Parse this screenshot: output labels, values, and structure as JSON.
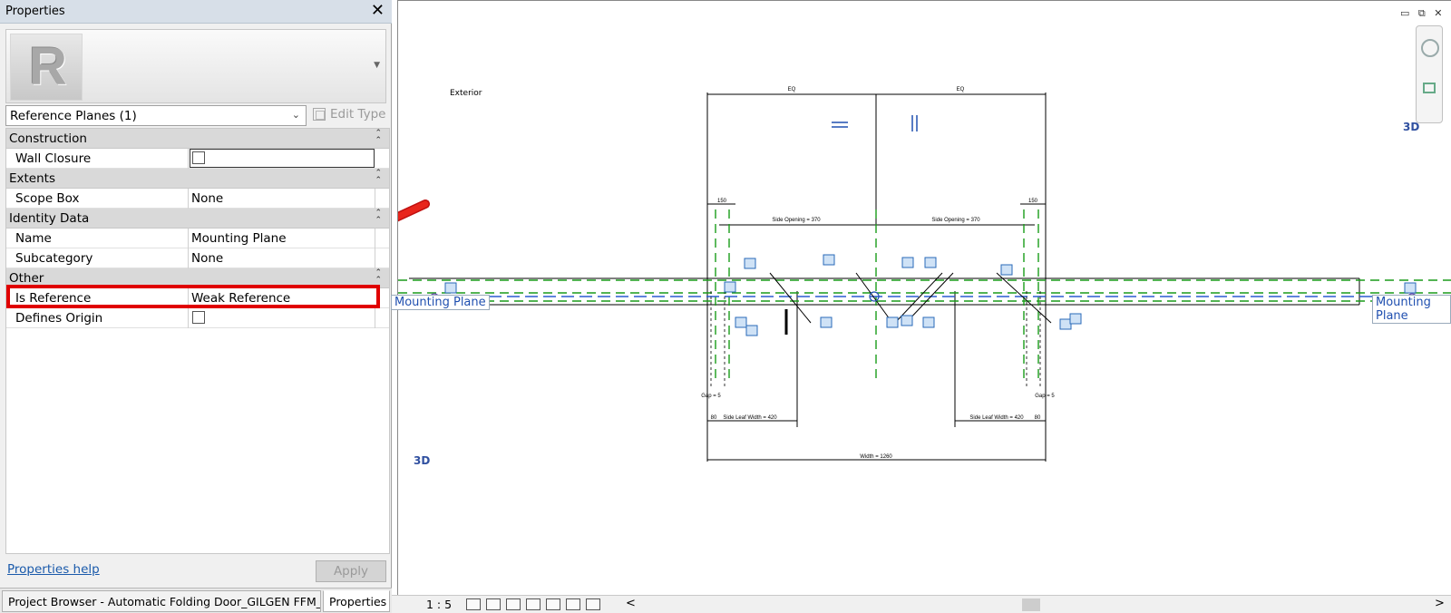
{
  "palette": {
    "title": "Properties",
    "close_glyph": "✕",
    "type_selector": "Reference Planes (1)",
    "edit_type": "Edit Type",
    "groups": {
      "construction": "Construction",
      "extents": "Extents",
      "identity": "Identity Data",
      "other": "Other"
    },
    "rows": {
      "wall_closure": {
        "label": "Wall Closure",
        "checked": false
      },
      "scope_box": {
        "label": "Scope Box",
        "value": "None"
      },
      "name": {
        "label": "Name",
        "value": "Mounting Plane"
      },
      "subcategory": {
        "label": "Subcategory",
        "value": "None"
      },
      "is_reference": {
        "label": "Is Reference",
        "value": "Weak Reference"
      },
      "defines_origin": {
        "label": "Defines Origin",
        "checked": false
      }
    },
    "help_link": "Properties help",
    "apply": "Apply",
    "tabs": {
      "browser": "Project Browser - Automatic Folding Door_GILGEN FFM_O...",
      "properties": "Properties"
    }
  },
  "canvas": {
    "mounting_plane_left": "Mounting Plane",
    "mounting_plane_right": "Mounting Plane",
    "label_3d_left": "3D",
    "label_3d_right": "3D",
    "exterior": "Exterior",
    "dim_width": "Width = 1260",
    "dim_side_opening_left": "Side Opening = 370",
    "dim_side_opening_right": "Side Opening = 370",
    "dim_side_leaf_left": "Side Leaf Width = 420",
    "dim_side_leaf_right": "Side Leaf Width = 420",
    "dim_top_left": "EQ",
    "dim_top_right": "EQ",
    "dim_small_left": "150",
    "dim_small_right": "150",
    "dim_gap_left": "Gap = 5",
    "dim_gap_right": "Gap = 5",
    "dim_80_left": "80",
    "dim_80_right": "80",
    "win_controls": "▭ ⧉ ✕"
  },
  "status": {
    "scale": "1 : 5",
    "scroll_left": "<",
    "scroll_right": ">"
  },
  "colors": {
    "highlight": "#e00000",
    "arrow": "#e8251c",
    "ref_plane": "#1a9c1a",
    "dimension": "#000000",
    "lock": "#2a6ab8"
  }
}
